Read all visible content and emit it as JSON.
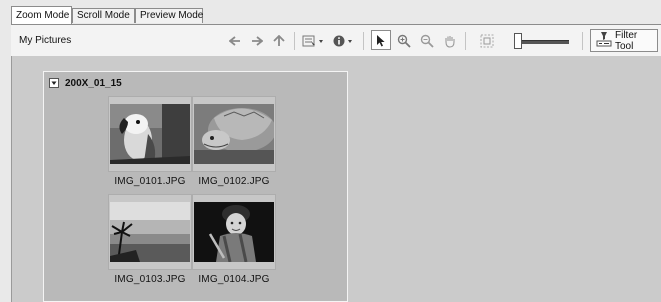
{
  "tabs": [
    {
      "label": "Zoom Mode",
      "active": true
    },
    {
      "label": "Scroll Mode",
      "active": false
    },
    {
      "label": "Preview Mode",
      "active": false
    }
  ],
  "toolbar": {
    "location": "My Pictures",
    "icons": [
      "back-arrow",
      "forward-arrow",
      "up-arrow",
      "view-options",
      "info",
      "select-pointer",
      "zoom-in",
      "zoom-out",
      "hand-pan",
      "fit-to-window",
      "zoom-slider"
    ],
    "filter_label": "Filter Tool",
    "zoom_slider_fraction": 0.05
  },
  "group": {
    "title": "200X_01_15",
    "items": [
      {
        "filename": "IMG_0101.JPG",
        "subject": "parrot"
      },
      {
        "filename": "IMG_0102.JPG",
        "subject": "tortoise"
      },
      {
        "filename": "IMG_0103.JPG",
        "subject": "sunset"
      },
      {
        "filename": "IMG_0104.JPG",
        "subject": "child-in-winter-clothes"
      }
    ]
  }
}
